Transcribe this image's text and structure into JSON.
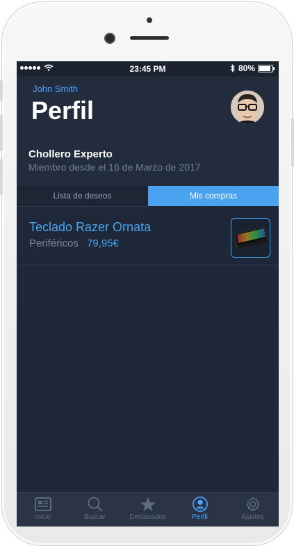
{
  "status_bar": {
    "time": "23:45 PM",
    "battery": "80%",
    "battery_level": 0.8
  },
  "profile": {
    "username": "John Smith",
    "title": "Perfil",
    "rank": "Chollero Experto",
    "member_since": "Miembro desde el 16 de Marzo de 2017"
  },
  "tabs": [
    {
      "label": "Lista de deseos",
      "active": false
    },
    {
      "label": "Mis compras",
      "active": true
    }
  ],
  "purchases": [
    {
      "title": "Teclado Razer Ornata",
      "category": "Periféricos",
      "price": "79,95€"
    }
  ],
  "tabbar": [
    {
      "label": "Inicio",
      "icon": "news-icon",
      "active": false
    },
    {
      "label": "Buscar",
      "icon": "search-icon",
      "active": false
    },
    {
      "label": "Destacados",
      "icon": "star-icon",
      "active": false
    },
    {
      "label": "Perfil",
      "icon": "user-icon",
      "active": true
    },
    {
      "label": "Ajustes",
      "icon": "gear-icon",
      "active": false
    }
  ],
  "colors": {
    "accent": "#4aa3f0",
    "background": "#1f2838",
    "header": "#232c3d"
  }
}
